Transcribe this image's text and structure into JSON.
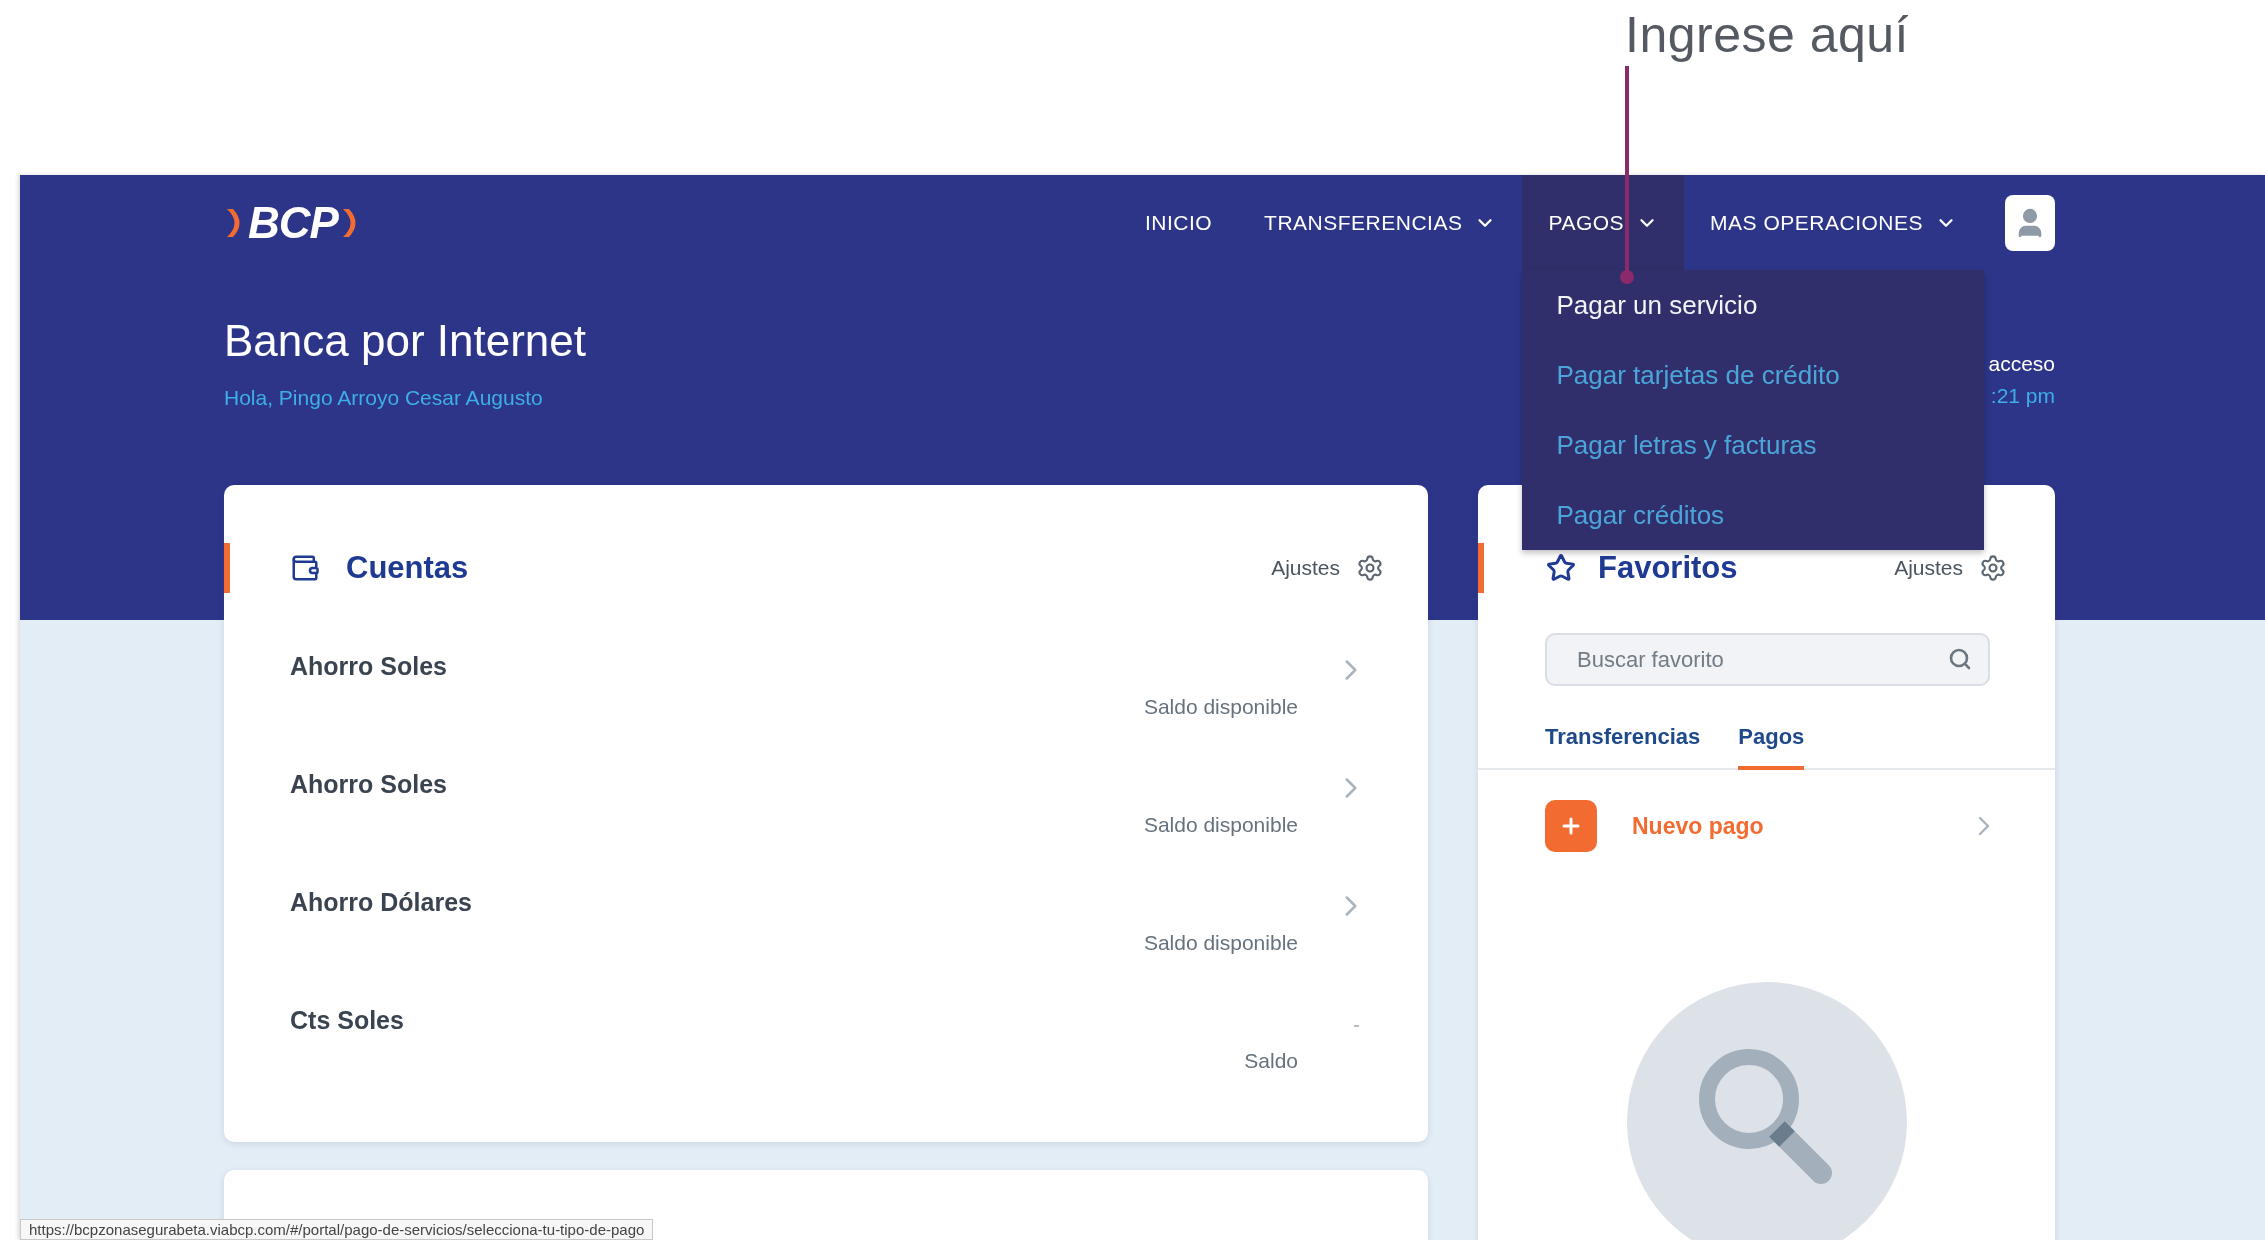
{
  "annotation": {
    "text": "Ingrese aquí"
  },
  "header": {
    "logo": "BCP",
    "nav": [
      {
        "label": "INICIO",
        "has_menu": false,
        "expanded": false
      },
      {
        "label": "TRANSFERENCIAS",
        "has_menu": true,
        "expanded": false
      },
      {
        "label": "PAGOS",
        "has_menu": true,
        "expanded": true,
        "menu": [
          {
            "label": "Pagar un servicio",
            "selected": true
          },
          {
            "label": "Pagar tarjetas de crédito",
            "selected": false
          },
          {
            "label": "Pagar letras y facturas",
            "selected": false
          },
          {
            "label": "Pagar créditos",
            "selected": false
          }
        ]
      },
      {
        "label": "MAS OPERACIONES",
        "has_menu": true,
        "expanded": false
      }
    ],
    "title": "Banca por Internet",
    "greeting": "Hola, Pingo Arroyo Cesar Augusto",
    "last_access": [
      "acceso",
      ":21 pm"
    ]
  },
  "accounts_card": {
    "title": "Cuentas",
    "settings": "Ajustes",
    "accounts": [
      {
        "name": "Ahorro Soles",
        "balance_label": "Saldo disponible",
        "kind": "chevron"
      },
      {
        "name": "Ahorro Soles",
        "balance_label": "Saldo disponible",
        "kind": "chevron"
      },
      {
        "name": "Ahorro Dólares",
        "balance_label": "Saldo disponible",
        "kind": "chevron"
      },
      {
        "name": "Cts Soles",
        "balance_label": "Saldo",
        "kind": "dash"
      }
    ]
  },
  "favorites_card": {
    "title": "Favoritos",
    "settings": "Ajustes",
    "search": {
      "placeholder": "Buscar favorito"
    },
    "tabs": [
      {
        "label": "Transferencias",
        "selected": false
      },
      {
        "label": "Pagos",
        "selected": true
      }
    ],
    "new_payment": {
      "label": "Nuevo pago"
    }
  },
  "status_bar": {
    "url": "https://bcpzonasegurabeta.viabcp.com/#/portal/pago-de-servicios/selecciona-tu-tipo-de-pago"
  }
}
